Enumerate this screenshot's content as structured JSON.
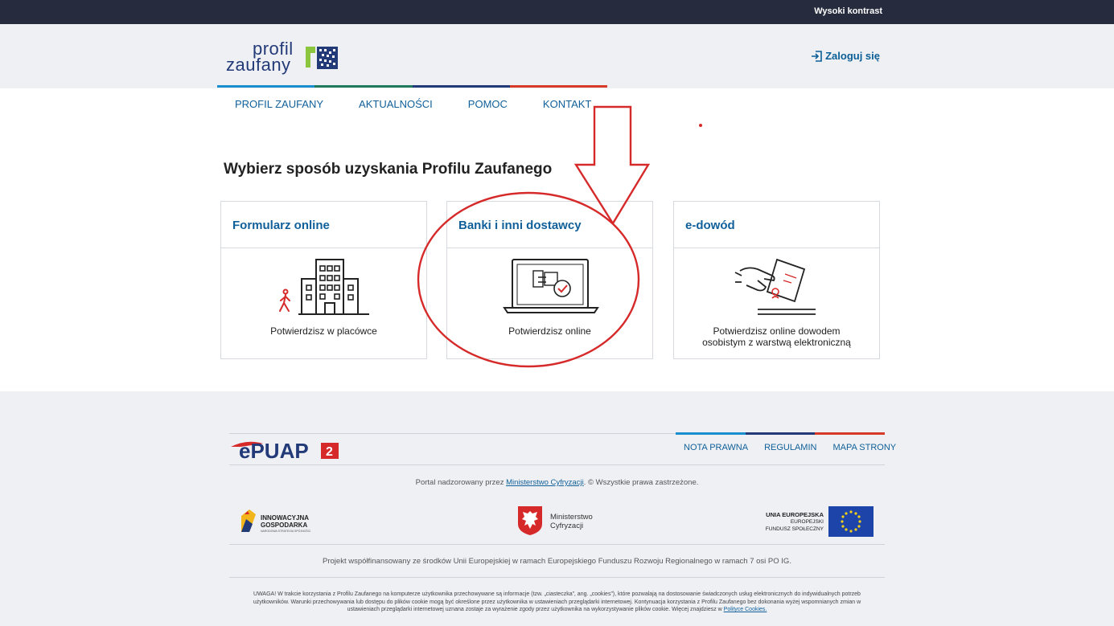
{
  "topbar": {
    "high_contrast": "Wysoki kontrast"
  },
  "header": {
    "logo_word1": "profil",
    "logo_word2": "zaufany",
    "login_label": "Zaloguj się"
  },
  "nav": {
    "items": [
      {
        "label": "PROFIL ZAUFANY"
      },
      {
        "label": "AKTUALNOŚCI"
      },
      {
        "label": "POMOC"
      },
      {
        "label": "KONTAKT"
      }
    ],
    "line_colors": [
      "#1a8fd0",
      "#1e7a5a",
      "#233a78",
      "#d83a2a"
    ]
  },
  "main": {
    "heading": "Wybierz sposób uzyskania Profilu Zaufanego",
    "cards": [
      {
        "title": "Formularz online",
        "description": "Potwierdzisz w placówce",
        "icon": "building-icon"
      },
      {
        "title": "Banki i inni dostawcy",
        "description": "Potwierdzisz online",
        "icon": "laptop-icon"
      },
      {
        "title": "e-dowód",
        "description_line1": "Potwierdzisz online dowodem",
        "description_line2": "osobistym z warstwą elektroniczną",
        "icon": "id-card-hand-icon"
      }
    ]
  },
  "footer": {
    "links": [
      {
        "label": "NOTA PRAWNA"
      },
      {
        "label": "REGULAMIN"
      },
      {
        "label": "MAPA STRONY"
      }
    ],
    "epuap_text": "ePUAP",
    "epuap_version": "2",
    "supervised_pre": "Portal nadzorowany przez ",
    "supervised_link": "Ministerstwo Cyfryzacji",
    "supervised_post": ". © Wszystkie prawa zastrzeżone.",
    "logo_ig_line1": "INNOWACYJNA",
    "logo_ig_line2": "GOSPODARKA",
    "logo_ig_line3": "NARODOWA STRATEGIA SPÓJNOŚCI",
    "logo_mc_line1": "Ministerstwo",
    "logo_mc_line2": "Cyfryzacji",
    "logo_eu_line1": "UNIA EUROPEJSKA",
    "logo_eu_line2": "EUROPEJSKI",
    "logo_eu_line3": "FUNDUSZ SPOŁECZNY",
    "cofinance": "Projekt współfinansowany ze środków Unii Europejskiej w ramach Europejskiego Funduszu Rozwoju Regionalnego w ramach 7 osi PO IG.",
    "cookie_line1": "UWAGA! W trakcie korzystania z Profilu Zaufanego na komputerze użytkownika przechowywane są informacje (tzw. „ciasteczka”, ang. „cookies”), które pozwalają na dostosowanie świadczonych usług elektronicznych do indywidualnych potrzeb",
    "cookie_line2": "użytkowników. Warunki przechowywania lub dostępu do plików cookie mogą być określone przez użytkownika w ustawieniach przeglądarki internetowej. Kontynuacja korzystania z Profilu Zaufanego bez dokonania wyżej wspomnianych zmian w",
    "cookie_line3": "ustawieniach przeglądarki internetowej uznana zostaje za wyrażenie zgody przez użytkownika na wykorzystywanie plików cookie. Więcej znajdziesz w ",
    "cookie_link": "Polityce Cookies."
  },
  "colors": {
    "topbar": "#262c3e",
    "link_blue": "#11609a",
    "annotation_red": "#d62a2a"
  }
}
